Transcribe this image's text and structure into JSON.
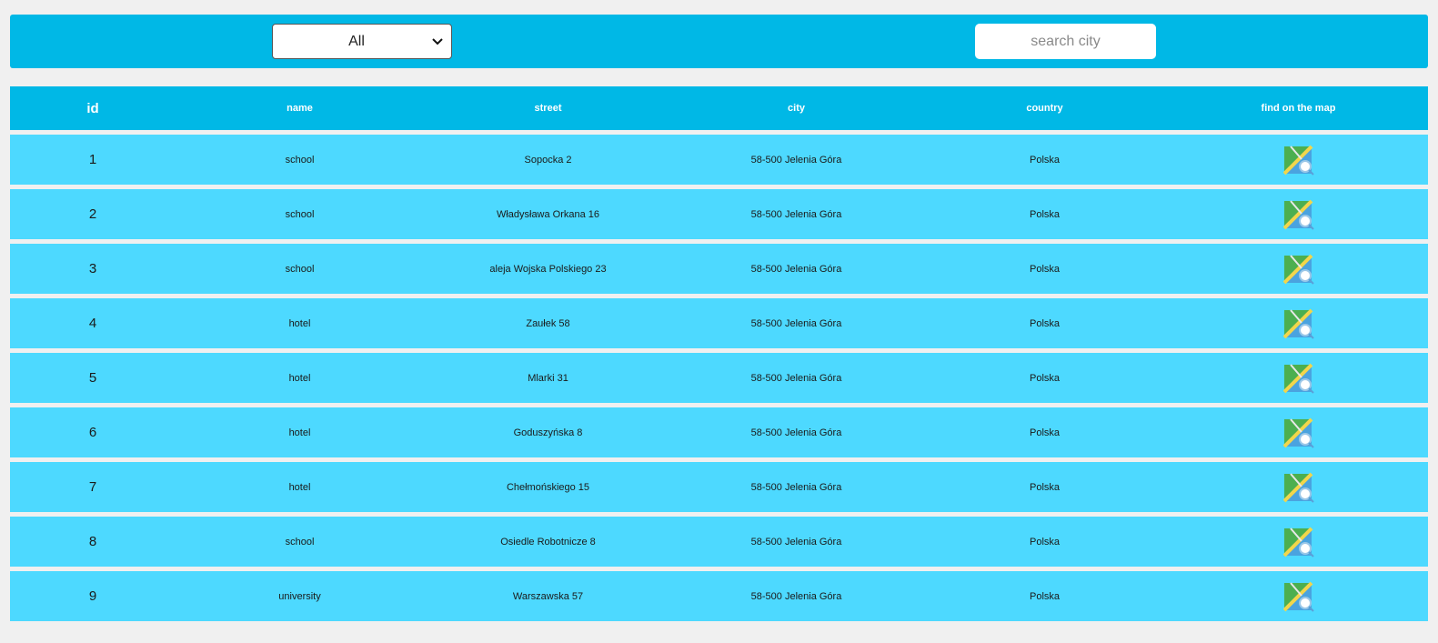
{
  "toolbar": {
    "filter": {
      "selected": "All",
      "icon": "chevron-down-icon"
    },
    "search": {
      "placeholder": "search city",
      "value": ""
    },
    "color": "#00b8e6"
  },
  "table": {
    "headers": {
      "id": "id",
      "name": "name",
      "street": "street",
      "city": "city",
      "country": "country",
      "map": "find on the map"
    },
    "row_color": "#4dd9ff",
    "map_icon": "map-search-icon",
    "rows": [
      {
        "id": "1",
        "name": "school",
        "street": "Sopocka 2",
        "city": "58-500 Jelenia Góra",
        "country": "Polska"
      },
      {
        "id": "2",
        "name": "school",
        "street": "Władysława Orkana 16",
        "city": "58-500 Jelenia Góra",
        "country": "Polska"
      },
      {
        "id": "3",
        "name": "school",
        "street": "aleja Wojska Polskiego 23",
        "city": "58-500 Jelenia Góra",
        "country": "Polska"
      },
      {
        "id": "4",
        "name": "hotel",
        "street": "Zaułek 58",
        "city": "58-500 Jelenia Góra",
        "country": "Polska"
      },
      {
        "id": "5",
        "name": "hotel",
        "street": "Mlarki 31",
        "city": "58-500 Jelenia Góra",
        "country": "Polska"
      },
      {
        "id": "6",
        "name": "hotel",
        "street": "Goduszyńska 8",
        "city": "58-500 Jelenia Góra",
        "country": "Polska"
      },
      {
        "id": "7",
        "name": "hotel",
        "street": "Chełmońskiego 15",
        "city": "58-500 Jelenia Góra",
        "country": "Polska"
      },
      {
        "id": "8",
        "name": "school",
        "street": "Osiedle Robotnicze 8",
        "city": "58-500 Jelenia Góra",
        "country": "Polska"
      },
      {
        "id": "9",
        "name": "university",
        "street": "Warszawska 57",
        "city": "58-500 Jelenia Góra",
        "country": "Polska"
      }
    ]
  }
}
